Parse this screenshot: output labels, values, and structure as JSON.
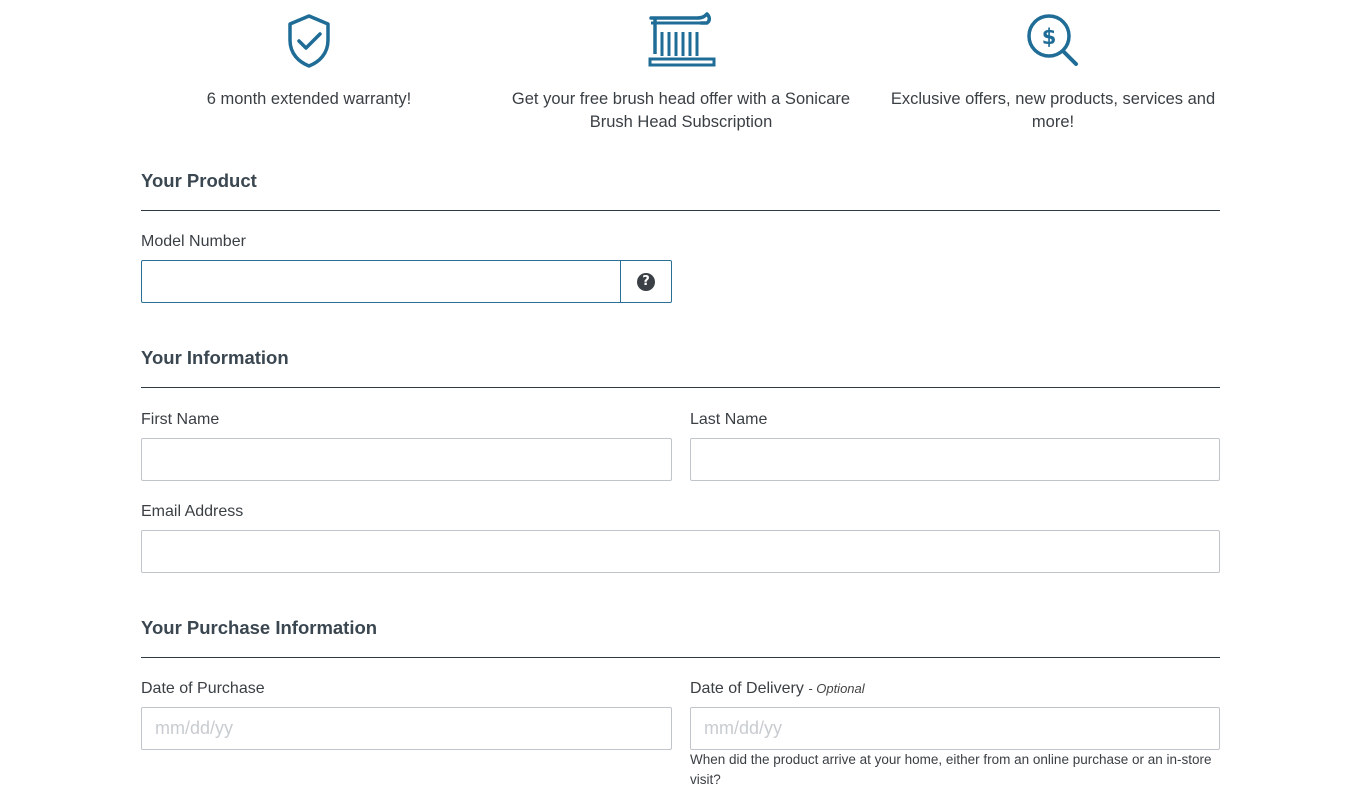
{
  "benefits": [
    {
      "icon": "shield-check-icon",
      "text": "6 month extended warranty!"
    },
    {
      "icon": "toothbrush-icon",
      "text": "Get your free brush head offer with a Sonicare Brush Head Subscription"
    },
    {
      "icon": "dollar-search-icon",
      "text": "Exclusive offers, new products, services and more!"
    }
  ],
  "product": {
    "title": "Your Product",
    "model_label": "Model Number",
    "model_value": "",
    "help_symbol": "?"
  },
  "information": {
    "title": "Your Information",
    "first_name_label": "First Name",
    "last_name_label": "Last Name",
    "email_label": "Email Address"
  },
  "purchase": {
    "title": "Your Purchase Information",
    "date_purchase_label": "Date of Purchase",
    "date_purchase_placeholder": "mm/dd/yy",
    "date_delivery_label": "Date of Delivery",
    "date_delivery_optional": "- Optional",
    "date_delivery_placeholder": "mm/dd/yy",
    "delivery_hint": "When did the product arrive at your home, either from an online purchase or an in-store visit?"
  },
  "colors": {
    "accent": "#1f6d97",
    "rule": "#2f3a42",
    "text": "#3a3f44"
  }
}
